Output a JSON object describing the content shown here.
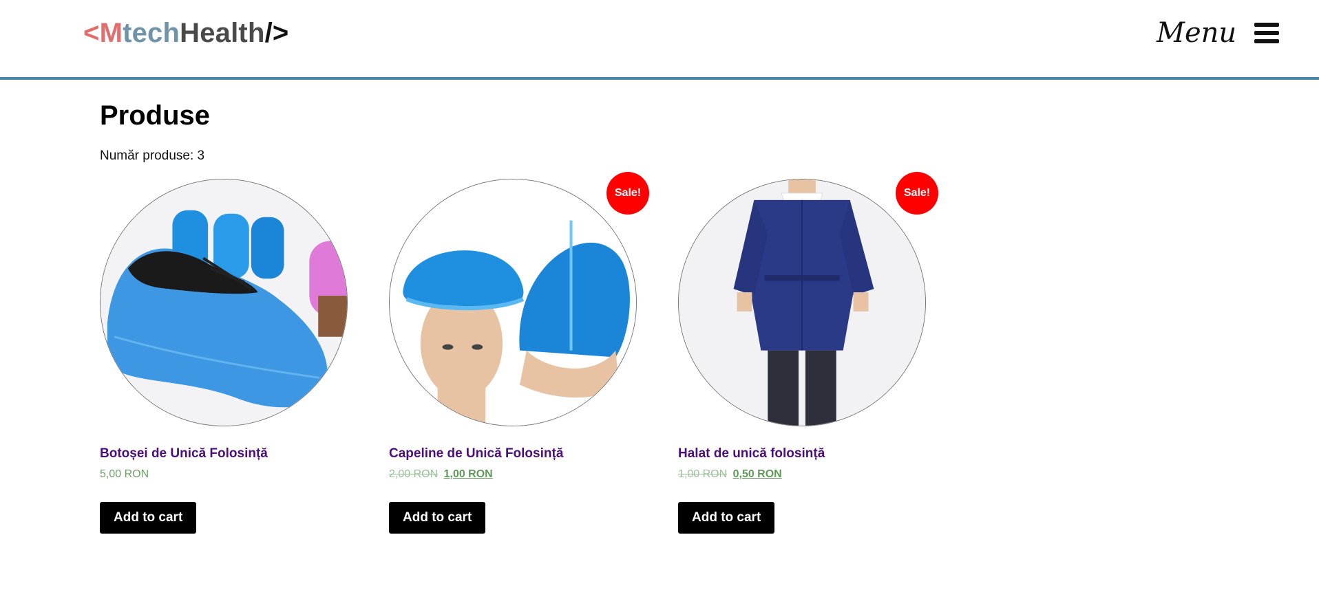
{
  "logo": {
    "lt": "<",
    "m": "M",
    "tech": "tech",
    "health": "Health",
    "end": "/>"
  },
  "header": {
    "menu_label": "Menu",
    "menu_icon": "hamburger-icon"
  },
  "page": {
    "title": "Produse",
    "result_count": "Număr produse: 3"
  },
  "products": [
    {
      "name": "Botoșei de Unică Folosință",
      "price": "5,00 RON",
      "old_price": "",
      "sale_price": "",
      "on_sale": false,
      "button": "Add to cart"
    },
    {
      "name": "Capeline de Unică Folosință",
      "price": "",
      "old_price": "2,00 RON",
      "sale_price": "1,00 RON",
      "on_sale": true,
      "badge": "Sale!",
      "button": "Add to cart"
    },
    {
      "name": "Halat de unică folosință",
      "price": "",
      "old_price": "1,00 RON",
      "sale_price": "0,50 RON",
      "on_sale": true,
      "badge": "Sale!",
      "button": "Add to cart"
    }
  ],
  "colors": {
    "accent_border": "#4a86a6",
    "logo_red": "#e26d6d",
    "logo_blue": "#6f94aa",
    "product_title": "#4b0f7a",
    "price_green": "#6f9e6a",
    "sale_badge": "#ff0000"
  }
}
